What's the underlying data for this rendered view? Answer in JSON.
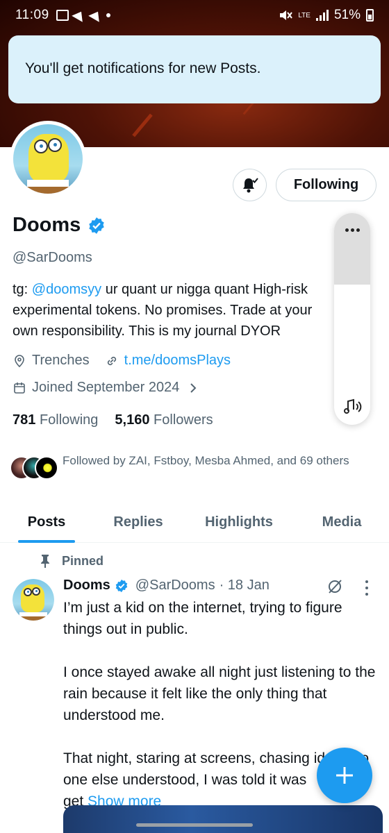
{
  "status_bar": {
    "time": "11:09",
    "network_label": "LTE",
    "battery": "51%"
  },
  "toast": {
    "message": "You'll get notifications for new Posts."
  },
  "profile": {
    "name": "Dooms",
    "handle": "@SarDooms",
    "bio_line1_prefix": "tg: ",
    "bio_link": "@doomsyy",
    "bio_line1_rest": " ur quant  ur nigga quant High-risk",
    "bio_line2": "experimental tokens. No promises. Trade at your",
    "bio_line3": "own responsibility.  This is my journal  DYOR",
    "location": "Trenches",
    "website": "t.me/doomsPlays",
    "joined": "Joined September 2024",
    "following_count": "781",
    "following_label": "Following",
    "followers_count": "5,160",
    "followers_label": "Followers",
    "followed_by": "Followed by ZAI, Fstboy, Mesba Ahmed, and 69 others"
  },
  "actions": {
    "following_button": "Following"
  },
  "tabs": [
    {
      "label": "Posts",
      "active": true
    },
    {
      "label": "Replies",
      "active": false
    },
    {
      "label": "Highlights",
      "active": false
    },
    {
      "label": "Media",
      "active": false
    }
  ],
  "post": {
    "pinned_label": "Pinned",
    "author": "Dooms",
    "handle": "@SarDooms",
    "date": "· 18 Jan",
    "para1": "I’m just a kid on the internet, trying to figure things out in public.",
    "para2": "I once stayed awake all night just listening to the rain because it felt like the only thing that understood me.",
    "para3": "That night, staring at screens, chasing ideas no one else understood, I was told it was",
    "para3_end": "get ",
    "show_more": "Show more"
  },
  "colors": {
    "accent": "#1d9bf0",
    "toast_bg": "#dbf1fb",
    "text_secondary": "#536471"
  },
  "icons": {
    "bell": "bell-check-icon",
    "verified": "verified-badge-icon",
    "location": "location-pin-icon",
    "link": "link-icon",
    "calendar": "calendar-icon",
    "pin": "pin-icon",
    "grok": "grok-icon",
    "more": "more-vertical-icon",
    "compose": "plus-icon",
    "music": "music-volume-icon"
  }
}
